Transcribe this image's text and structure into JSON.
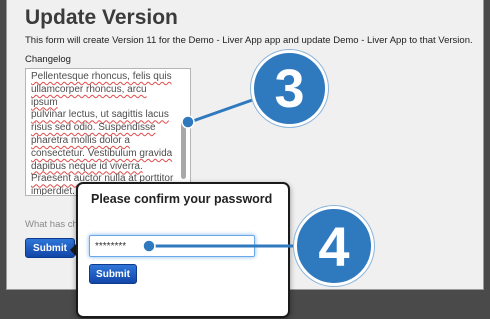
{
  "page": {
    "title": "Update Version",
    "description": "This form will create Version 11 for the Demo - Liver App app and update Demo - Liver App to that Version.",
    "changelog_label": "Changelog",
    "changelog_lines": [
      "Pellentesque rhoncus, felis quis",
      "ullamcorper rhoncus, arcu ipsum",
      "pulvinar lectus, ut sagittis lacus",
      "risus sed odio. Suspendisse",
      "pharetra mollis dolor a",
      "consectetur. Vestibulum gravida",
      "dapibus neque id viverra.",
      "Praesent auctor nulla at porttitor",
      "imperdiet."
    ],
    "hint_text": "What has ch",
    "submit_label": "Submit"
  },
  "modal": {
    "title": "Please confirm your password",
    "password_value": "********",
    "submit_label": "Submit"
  },
  "callouts": {
    "step3": "3",
    "step4": "4"
  },
  "colors": {
    "accent": "#2f79bf",
    "button": "#1a52b8",
    "spellcheck": "#e04b4b"
  }
}
